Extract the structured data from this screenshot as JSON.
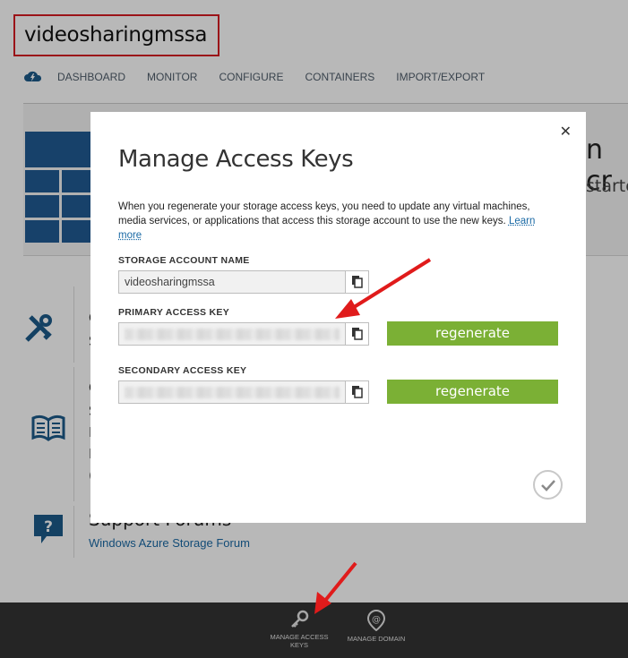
{
  "page": {
    "title": "videosharingmssa",
    "nav": [
      "DASHBOARD",
      "MONITOR",
      "CONFIGURE",
      "CONTAINERS",
      "IMPORT/EXPORT"
    ],
    "banner_fragment_1": "n cr",
    "banner_fragment_2": "starte",
    "fragments": [
      "C",
      "S",
      "C",
      "S",
      "I",
      "I",
      "("
    ],
    "forums_title": "Support Forums",
    "forums_link": "Windows Azure Storage Forum"
  },
  "modal": {
    "title": "Manage Access Keys",
    "description": "When you regenerate your storage access keys, you need to update any virtual machines, media services, or applications that access this storage account to use the new keys.",
    "learn_more": "Learn more",
    "storage_account_label": "STORAGE ACCOUNT NAME",
    "storage_account_value": "videosharingmssa",
    "primary_key_label": "PRIMARY ACCESS KEY",
    "secondary_key_label": "SECONDARY ACCESS KEY",
    "regenerate_label": "regenerate",
    "close_glyph": "✕",
    "accent": "#7bb035"
  },
  "commandbar": {
    "manage_keys": "MANAGE ACCESS KEYS",
    "manage_domain": "MANAGE DOMAIN",
    "background": "#252525"
  },
  "icons": [
    "cloud-icon",
    "tools-icon",
    "book-icon",
    "question-bubble-icon",
    "copy-icon",
    "checkmark-icon",
    "key-icon",
    "at-sign-icon",
    "close-icon"
  ]
}
